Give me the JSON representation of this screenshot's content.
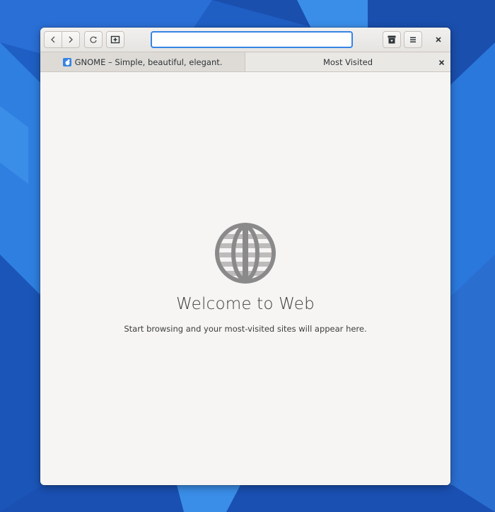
{
  "window": {
    "url_value": "",
    "url_placeholder": ""
  },
  "tabs": [
    {
      "label": "GNOME – Simple, beautiful, elegant.",
      "favicon": "gnome-favicon",
      "active": false
    },
    {
      "label": "Most Visited",
      "active": true
    }
  ],
  "main": {
    "title": "Welcome to Web",
    "subtitle": "Start browsing and your most-visited sites will appear here."
  },
  "colors": {
    "accent": "#3584e4",
    "desktop": "#1f5fc4",
    "globe": "#8a8a8a"
  },
  "icons": {
    "back": "go-previous-icon",
    "forward": "go-next-icon",
    "reload": "reload-icon",
    "new_tab": "new-tab-icon",
    "downloads": "downloads-icon",
    "menu": "hamburger-menu-icon",
    "close": "close-icon",
    "welcome": "globe-icon"
  }
}
